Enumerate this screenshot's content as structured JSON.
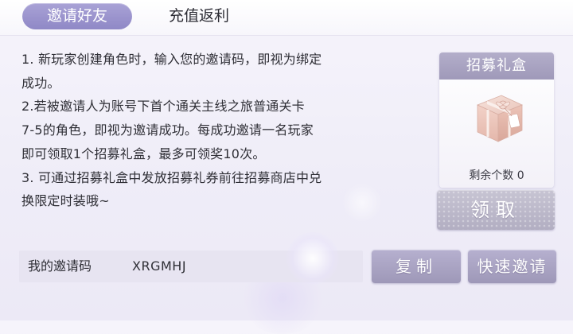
{
  "tabs": [
    {
      "label": "邀请好友",
      "active": true
    },
    {
      "label": "充值返利",
      "active": false
    }
  ],
  "rules": {
    "lines": [
      "1. 新玩家创建角色时，输入您的邀请码，即视为绑定",
      "成功。",
      "2.若被邀请人为账号下首个通关主线之旅普通关卡",
      "7-5的角色，即视为邀请成功。每成功邀请一名玩家",
      "即可领取1个招募礼盒，最多可领奖10次。",
      "3. 可通过招募礼盒中发放招募礼券前往招募商店中兑",
      "换限定时装哦~"
    ]
  },
  "gift": {
    "title": "招募礼盒",
    "icon": "gift-box-icon",
    "remaining_label": "剩余个数",
    "remaining_count": "0"
  },
  "buttons": {
    "claim": "领取",
    "copy": "复制",
    "quick_invite": "快速邀请"
  },
  "invite_code": {
    "label": "我的邀请码",
    "value": "XRGMHJ"
  },
  "colors": {
    "accent": "#9b94cc",
    "button": "#a9a3c3",
    "background": "#f0eef8"
  }
}
